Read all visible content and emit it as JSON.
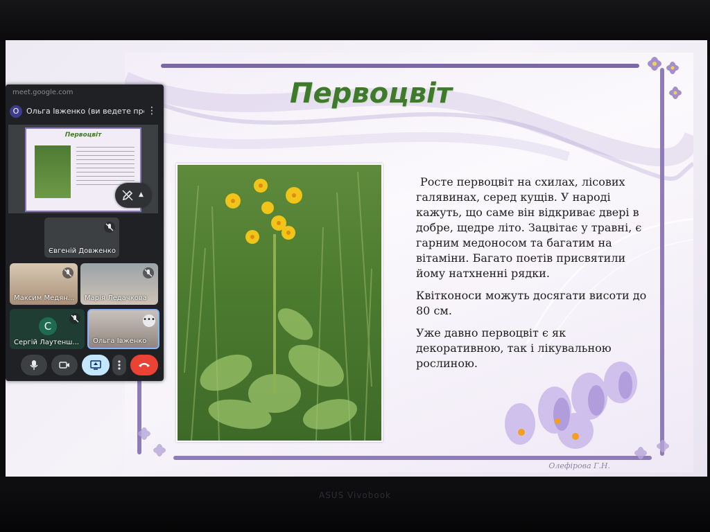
{
  "slide": {
    "title": "Первоцвіт",
    "paragraphs": [
      "Росте первоцвіт на схилах, лісових галявинах, серед кущів. У народі кажуть, що саме він відкриває двері в добре, щедре літо. Зацвітає у травні, є гарним медоносом та багатим на вітаміни. Багато поетів присвятили йому натхненні рядки.",
      "Квітконоси можуть досягати висоти до 80 см.",
      "Уже давно первоцвіт є як декоративною, так і лікувальною рослиною."
    ],
    "author": "Олефірова Г.Н."
  },
  "meet": {
    "url": "meet.google.com",
    "presenter_avatar": "О",
    "presenter_label": "Ольга Івженко (ви ведете презе...",
    "mini_slide_title": "Первоцвіт",
    "participants": [
      {
        "name": "Євгеній Довженко",
        "muted": true
      },
      {
        "name": "Максим Медян...",
        "muted": true
      },
      {
        "name": "Марія Ледачкова",
        "muted": true
      },
      {
        "name": "Сергій Лаутенш...",
        "muted": true,
        "avatar_letter": "С"
      },
      {
        "name": "Ольга Івженко",
        "muted": false
      }
    ],
    "controls": [
      "mic-icon",
      "camera-icon",
      "present-icon",
      "more-icon",
      "hangup-icon"
    ],
    "colors": {
      "panel": "#202124",
      "tile": "#3c4043",
      "hangup": "#ea4335",
      "present_active": "#c2e7ff"
    }
  },
  "device": {
    "brand": "ASUS Vivobook"
  }
}
